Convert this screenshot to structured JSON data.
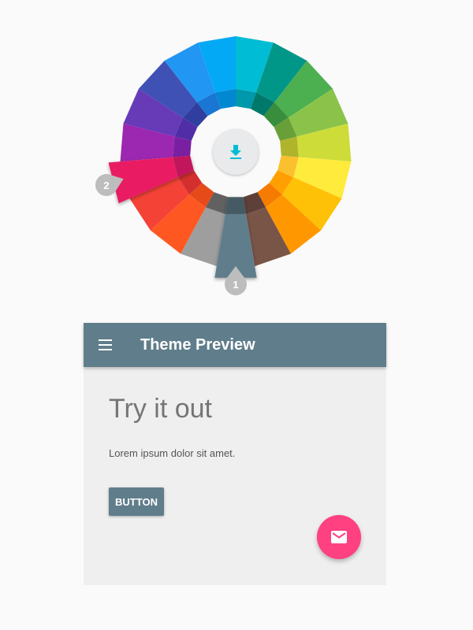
{
  "wheel": {
    "segments": [
      {
        "name": "cyan",
        "color": "#00bcd4",
        "inner": "#0098ab"
      },
      {
        "name": "teal",
        "color": "#009688",
        "inner": "#00796b"
      },
      {
        "name": "green",
        "color": "#4caf50",
        "inner": "#388e3c"
      },
      {
        "name": "light-green",
        "color": "#8bc34a",
        "inner": "#689f38"
      },
      {
        "name": "lime",
        "color": "#cddc39",
        "inner": "#afb42b"
      },
      {
        "name": "yellow",
        "color": "#ffeb3b",
        "inner": "#fbc02d"
      },
      {
        "name": "amber",
        "color": "#ffc107",
        "inner": "#ffa000"
      },
      {
        "name": "orange",
        "color": "#ff9800",
        "inner": "#f57c00"
      },
      {
        "name": "brown",
        "color": "#795548",
        "inner": "#5d4037"
      },
      {
        "name": "blue-grey",
        "color": "#607d8b",
        "inner": "#455a64"
      },
      {
        "name": "grey",
        "color": "#9e9e9e",
        "inner": "#616161"
      },
      {
        "name": "deep-orange",
        "color": "#ff5722",
        "inner": "#e64a19"
      },
      {
        "name": "red",
        "color": "#f44336",
        "inner": "#d32f2f"
      },
      {
        "name": "pink",
        "color": "#e91e63",
        "inner": "#c2185b"
      },
      {
        "name": "purple",
        "color": "#9c27b0",
        "inner": "#7b1fa2"
      },
      {
        "name": "deep-purple",
        "color": "#673ab7",
        "inner": "#512da8"
      },
      {
        "name": "indigo",
        "color": "#3f51b5",
        "inner": "#303f9f"
      },
      {
        "name": "blue",
        "color": "#2196f3",
        "inner": "#1976d2"
      },
      {
        "name": "light-blue",
        "color": "#03a9f4",
        "inner": "#0288d1"
      }
    ],
    "primary_selection": "blue-grey",
    "accent_selection": "pink",
    "markers": {
      "primary_label": "1",
      "accent_label": "2",
      "color": "#bdbdbd"
    },
    "center_button": {
      "icon": "download-icon",
      "icon_color": "#00bcd4",
      "background": "#e8eaeb"
    }
  },
  "preview": {
    "appbar": {
      "menu_icon": "menu-icon",
      "title": "Theme Preview",
      "color": "#607d8b"
    },
    "heading": "Try it out",
    "body": "Lorem ipsum dolor sit amet.",
    "button_label": "BUTTON",
    "fab": {
      "icon": "mail-icon",
      "color": "#ff4081"
    }
  }
}
